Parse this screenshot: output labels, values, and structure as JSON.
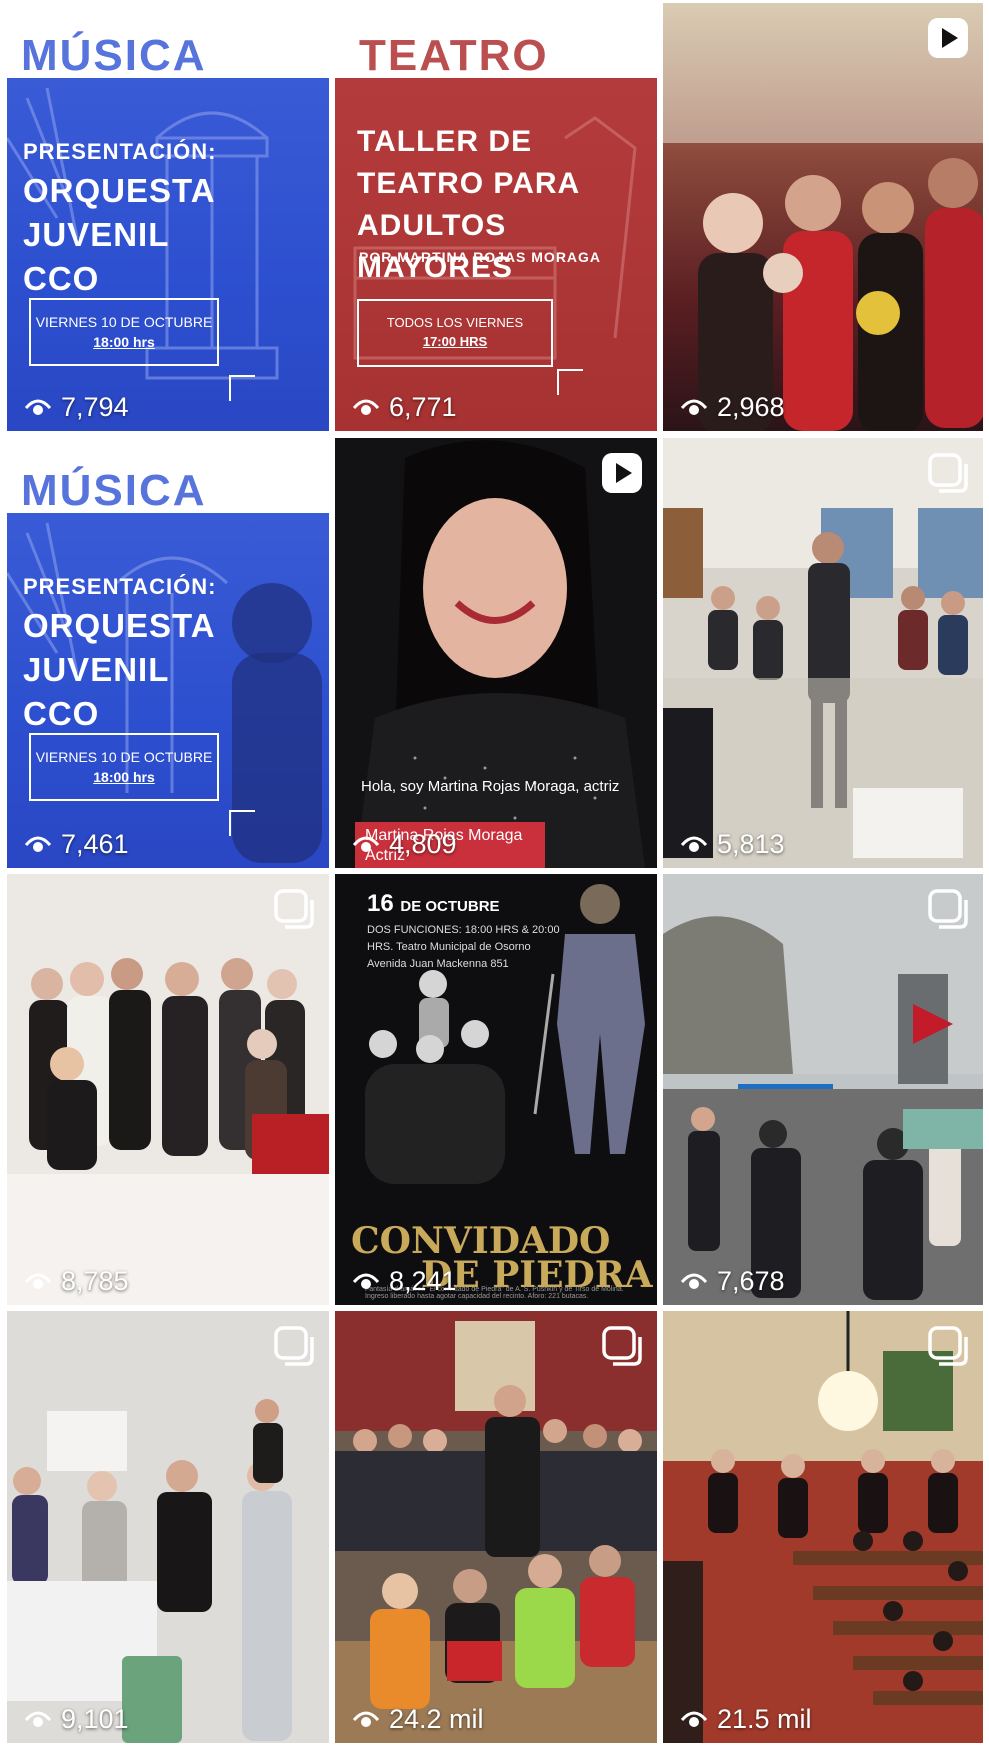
{
  "tiles": [
    {
      "views": "7,794",
      "type": "carousel",
      "category": "MÚSICA",
      "line1": "PRESENTACIÓN:",
      "line2": "ORQUESTA JUVENIL CCO",
      "date": "VIERNES 10 DE OCTUBRE",
      "time": "18:00 hrs"
    },
    {
      "views": "6,771",
      "type": "carousel",
      "category": "TEATRO",
      "title": "TALLER DE TEATRO PARA ADULTOS MAYORES",
      "subtitle": "POR MARTINA ROJAS MORAGA",
      "date": "TODOS LOS VIERNES",
      "time": "17:00 HRS"
    },
    {
      "views": "2,968",
      "type": "video"
    },
    {
      "views": "7,461",
      "type": "carousel",
      "category": "MÚSICA",
      "line1": "PRESENTACIÓN:",
      "line2": "ORQUESTA JUVENIL CCO",
      "date": "VIERNES 10 DE OCTUBRE",
      "time": "18:00 hrs"
    },
    {
      "views": "4,809",
      "type": "video",
      "caption": "Hola, soy Martina Rojas Moraga, actriz",
      "tag": "Martina Rojas Moraga Actriz"
    },
    {
      "views": "5,813",
      "type": "carousel"
    },
    {
      "views": "8,785",
      "type": "carousel"
    },
    {
      "views": "8,241",
      "type": "poster",
      "date_day": "16",
      "date_month": "DE OCTUBRE",
      "info": "DOS FUNCIONES: 18:00 HRS & 20:00 HRS. Teatro Municipal de Osorno Avenida Juan Mackenna 851",
      "title_a": "CONVIDADO",
      "title_b": "DE PIEDRA",
      "footer": "Fantasía dramática \"El convidado de Piedra\" de A. S. Pushkin y de Tirso de Molina. Ingreso liberado hasta agotar capacidad del recinto. Aforo: 221 butacas."
    },
    {
      "views": "7,678",
      "type": "carousel"
    },
    {
      "views": "9,101",
      "type": "carousel"
    },
    {
      "views": "24.2 mil",
      "type": "carousel"
    },
    {
      "views": "21.5 mil",
      "type": "carousel"
    }
  ],
  "icons": {
    "views": "eye-icon",
    "carousel": "carousel-icon",
    "video": "play-icon"
  }
}
